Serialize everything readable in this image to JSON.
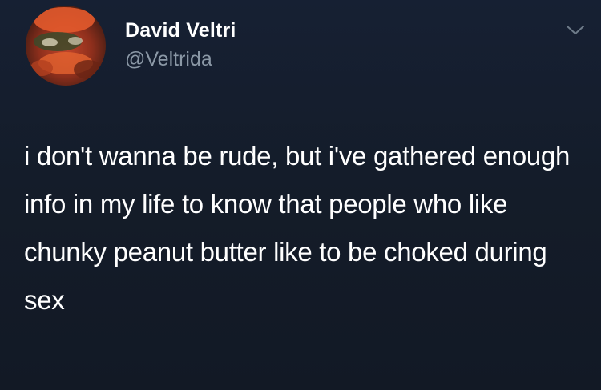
{
  "tweet": {
    "author": {
      "display_name": "David Veltri",
      "handle": "@Veltrida",
      "avatar_icon": "profile-photo"
    },
    "menu_icon": "chevron-down-icon",
    "text": "i don't wanna be rude, but i've gathered enough info in my life to know that people who like chunky peanut butter like to be choked during sex"
  },
  "colors": {
    "background": "#151d2a",
    "text_primary": "#ffffff",
    "text_secondary": "#8b98a6"
  }
}
